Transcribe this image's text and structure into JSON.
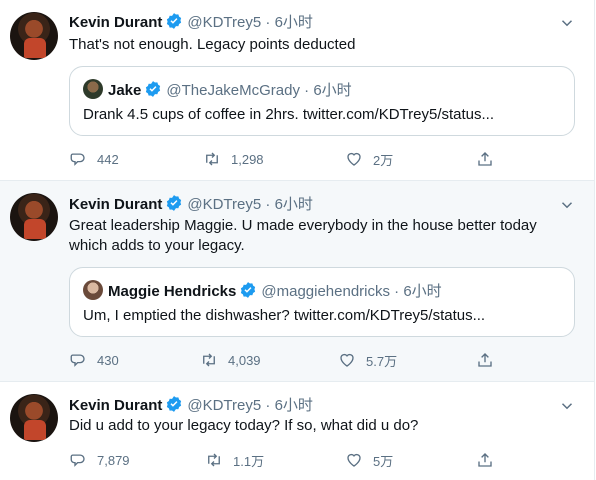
{
  "colors": {
    "icon": "#5b7083",
    "verified": "#1d9bf0",
    "highlight_bg": "#f5f8fa"
  },
  "tweets": [
    {
      "author": {
        "name": "Kevin Durant",
        "handle": "@KDTrey5",
        "verified": true
      },
      "time": "6小时",
      "text": [
        "That's not enough. Legacy points deducted"
      ],
      "quote": {
        "author": {
          "name": "Jake",
          "handle": "@TheJakeMcGrady",
          "verified": true
        },
        "time": "6小时",
        "text": "Drank 4.5 cups of coffee in 2hrs. twitter.com/KDTrey5/status..."
      },
      "stats": {
        "replies": "442",
        "retweets": "1,298",
        "likes": "2万"
      }
    },
    {
      "author": {
        "name": "Kevin Durant",
        "handle": "@KDTrey5",
        "verified": true
      },
      "time": "6小时",
      "text": [
        "Great leadership Maggie. U made everybody in the house better today",
        "which adds to your legacy."
      ],
      "quote": {
        "author": {
          "name": "Maggie Hendricks",
          "handle": "@maggiehendricks",
          "verified": true
        },
        "time": "6小时",
        "text": "Um, I emptied the dishwasher? twitter.com/KDTrey5/status..."
      },
      "stats": {
        "replies": "430",
        "retweets": "4,039",
        "likes": "5.7万"
      }
    },
    {
      "author": {
        "name": "Kevin Durant",
        "handle": "@KDTrey5",
        "verified": true
      },
      "time": "6小时",
      "text": [
        "Did u add to your legacy today? If so, what did u do?"
      ],
      "quote": null,
      "stats": {
        "replies": "7,879",
        "retweets": "1.1万",
        "likes": "5万"
      }
    }
  ],
  "icons": [
    "more-icon",
    "verified-icon",
    "reply-icon",
    "retweet-icon",
    "like-icon",
    "share-icon"
  ]
}
